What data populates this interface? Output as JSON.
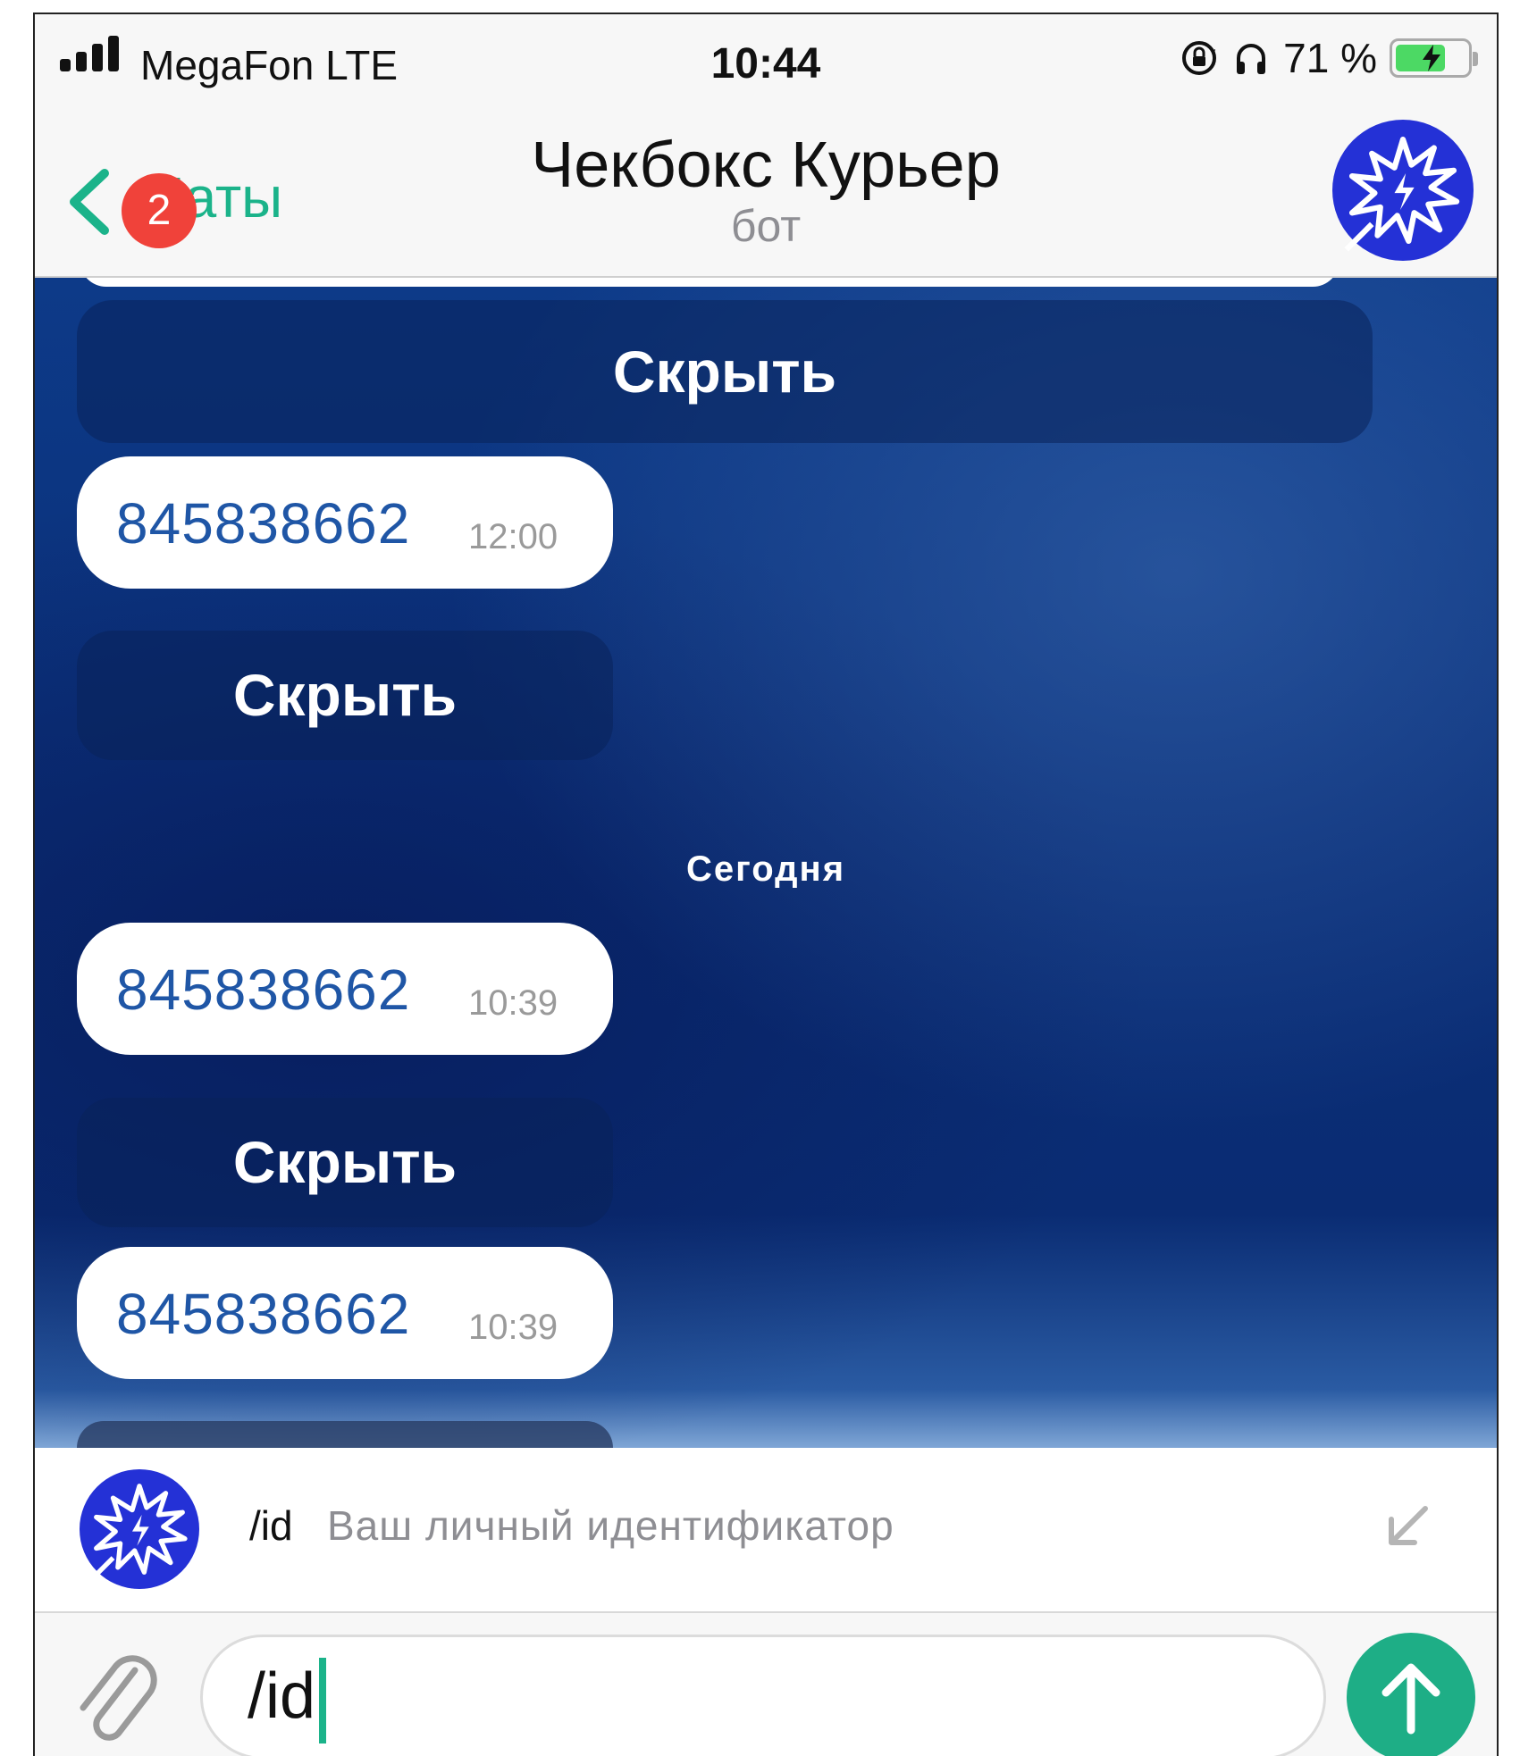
{
  "status_bar": {
    "carrier": "MegaFon   LTE",
    "time": "10:44",
    "battery_percent": "71 %",
    "battery_level": 0.71,
    "battery_charging": true
  },
  "nav": {
    "back_label": "Чаты",
    "unread_badge": "2",
    "title": "Чекбокс Курьер",
    "subtitle": "бот",
    "accent_color": "#1bb38a",
    "badge_color": "#f0423a"
  },
  "chat": {
    "keyboard_buttons": [
      "Скрыть",
      "Скрыть",
      "Скрыть"
    ],
    "messages": [
      {
        "text": "845838662",
        "time": "12:00"
      },
      {
        "text": "845838662",
        "time": "10:39"
      },
      {
        "text": "845838662",
        "time": "10:39"
      }
    ],
    "date_separator": "Сегодня"
  },
  "command_suggestion": {
    "command": "/id",
    "description": "Ваш личный идентификатор"
  },
  "input": {
    "value": "/id",
    "send_button_color": "#1eae86"
  },
  "icons": {
    "signal": "signal-bars-icon",
    "rotation_lock": "rotation-lock-icon",
    "headphones": "headphones-icon",
    "battery": "battery-icon",
    "back": "chevron-left-icon",
    "bot_avatar": "starburst-logo-icon",
    "collapse": "arrow-down-left-icon",
    "attach": "paperclip-icon",
    "send": "arrow-up-icon"
  }
}
